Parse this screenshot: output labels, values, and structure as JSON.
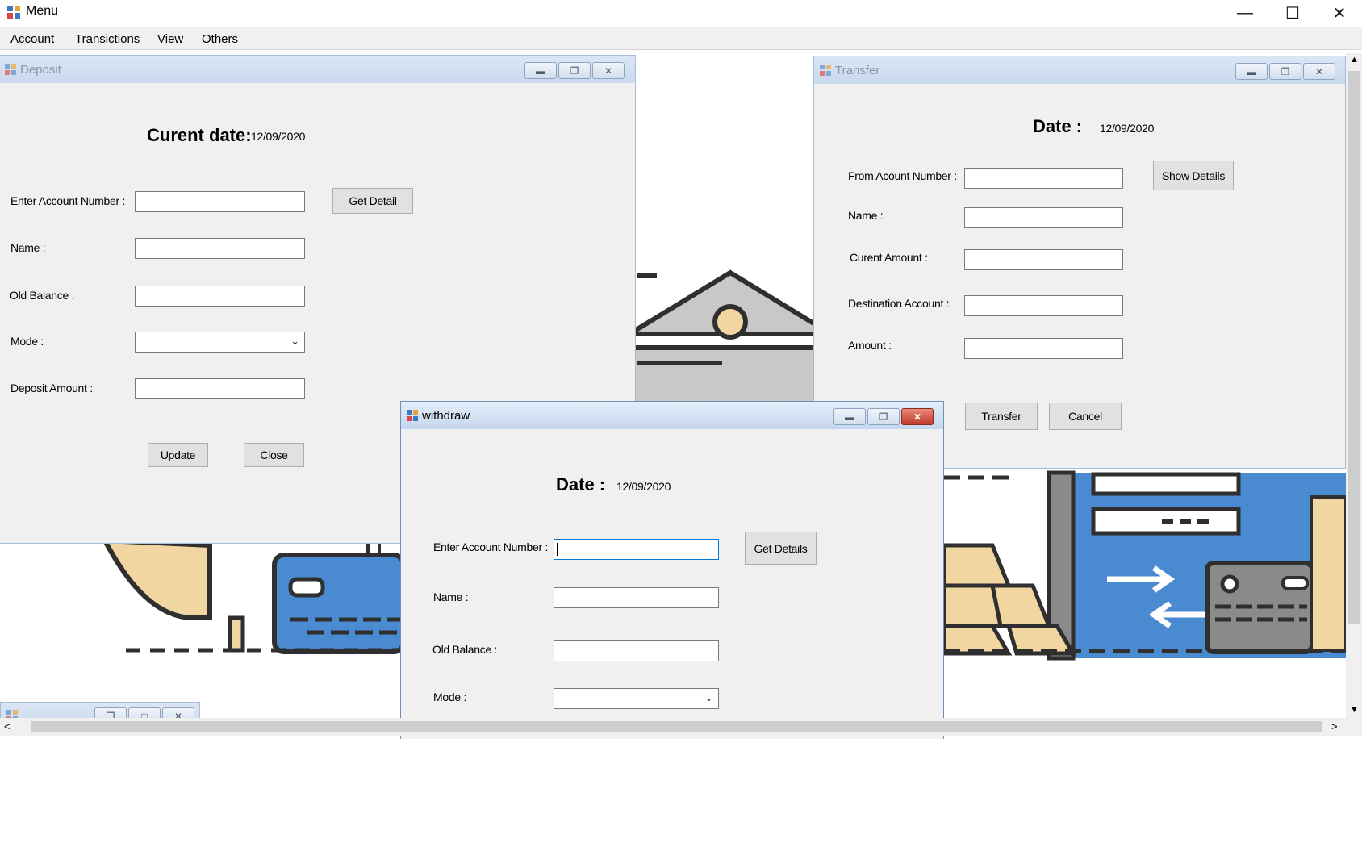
{
  "window": {
    "title": "Menu",
    "icon": "app-window-icon"
  },
  "menu": {
    "items": [
      "Account",
      "Transictions",
      "View",
      "Others"
    ]
  },
  "deposit": {
    "title": "Deposit",
    "date_label": "Curent date:",
    "date_value": "12/09/2020",
    "account_label": "Enter Account Number :",
    "get_detail": "Get Detail",
    "name_label": "Name :",
    "old_balance_label": "Old Balance :",
    "mode_label": "Mode :",
    "deposit_amount_label": "Deposit Amount :",
    "update": "Update",
    "close": "Close"
  },
  "transfer": {
    "title": "Transfer",
    "date_label": "Date :",
    "date_value": "12/09/2020",
    "from_label": "From Acount Number :",
    "show_details": "Show Details",
    "name_label": "Name :",
    "current_amount_label": "Curent Amount :",
    "destination_label": "Destination Account :",
    "amount_label": "Amount :",
    "transfer_btn": "Transfer",
    "cancel_btn": "Cancel"
  },
  "withdraw": {
    "title": "withdraw",
    "date_label": "Date :",
    "date_value": "12/09/2020",
    "account_label": "Enter Account Number :",
    "get_details": "Get Details",
    "name_label": "Name :",
    "old_balance_label": "Old Balance :",
    "mode_label": "Mode :"
  },
  "colors": {
    "accent_blue": "#4a8ad0",
    "gold": "#f2d6a2",
    "gray": "#c8c8c8",
    "dark": "#2f2f2f"
  }
}
